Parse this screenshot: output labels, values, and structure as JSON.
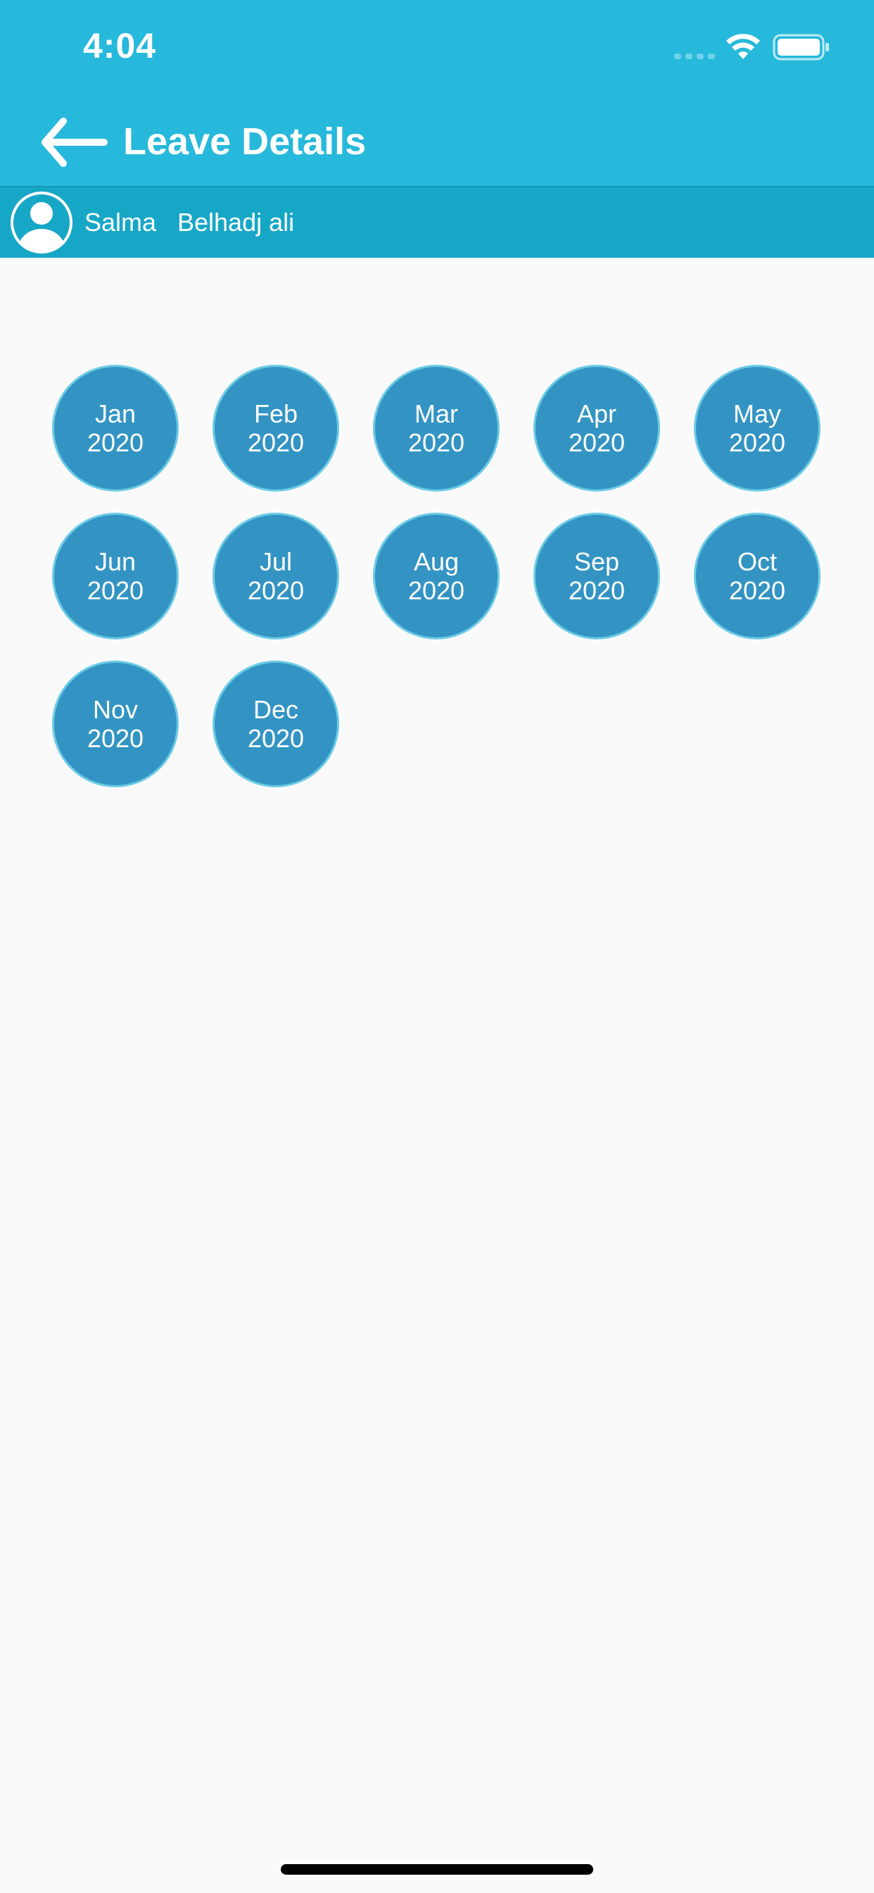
{
  "status_bar": {
    "time": "4:04"
  },
  "header": {
    "title": "Leave Details",
    "back_icon": "arrow-left-icon"
  },
  "user": {
    "first_name": "Salma",
    "last_name": "Belhadj ali",
    "avatar_icon": "user-avatar-icon"
  },
  "months": [
    {
      "month": "Jan",
      "year": "2020"
    },
    {
      "month": "Feb",
      "year": "2020"
    },
    {
      "month": "Mar",
      "year": "2020"
    },
    {
      "month": "Apr",
      "year": "2020"
    },
    {
      "month": "May",
      "year": "2020"
    },
    {
      "month": "Jun",
      "year": "2020"
    },
    {
      "month": "Jul",
      "year": "2020"
    },
    {
      "month": "Aug",
      "year": "2020"
    },
    {
      "month": "Sep",
      "year": "2020"
    },
    {
      "month": "Oct",
      "year": "2020"
    },
    {
      "month": "Nov",
      "year": "2020"
    },
    {
      "month": "Dec",
      "year": "2020"
    }
  ],
  "colors": {
    "header_bg": "#27b9db",
    "user_bar_bg": "#17a7c6",
    "month_circle": "#3394c3",
    "month_circle_border": "#6ccbe6",
    "page_bg": "#fafafa"
  }
}
